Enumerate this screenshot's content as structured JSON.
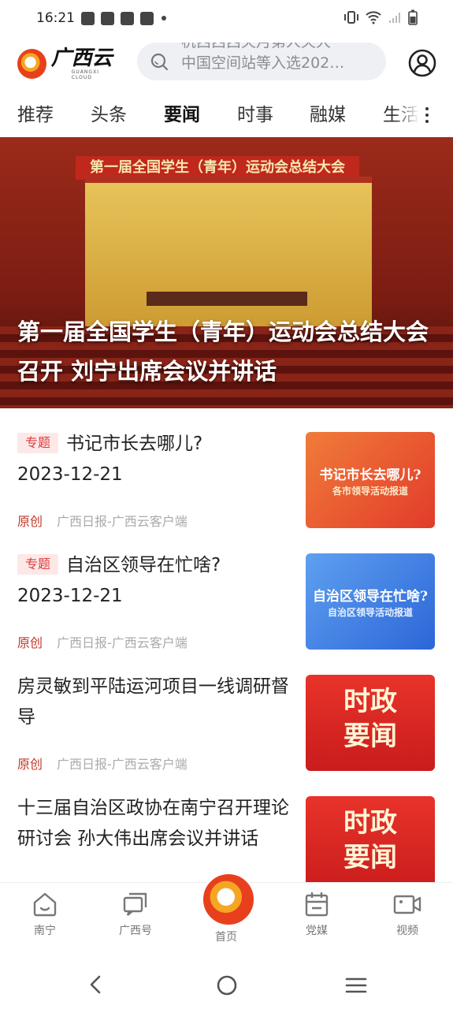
{
  "status": {
    "time": "16:21"
  },
  "app": {
    "logo_cn": "广西云",
    "logo_en": "GUANGXI CLOUD"
  },
  "search": {
    "line1": "杭西西西央月第人央大",
    "line2": "中国空间站等入选202…"
  },
  "tabs": [
    {
      "label": "推荐"
    },
    {
      "label": "头条"
    },
    {
      "label": "要闻"
    },
    {
      "label": "时事"
    },
    {
      "label": "融媒"
    },
    {
      "label": "生活"
    }
  ],
  "hero": {
    "banner": "第一届全国学生（青年）运动会总结大会",
    "title": "第一届全国学生（青年）运动会总结大会召开 刘宁出席会议并讲话"
  },
  "feed": [
    {
      "tag": "专题",
      "title": "书记市长去哪儿?",
      "date": "2023-12-21",
      "orig": "原创",
      "source": "广西日报-广西云客户端",
      "thumb_title": "书记市长去哪儿?",
      "thumb_sub": "各市领导活动报道"
    },
    {
      "tag": "专题",
      "title": "自治区领导在忙啥?",
      "date": "2023-12-21",
      "orig": "原创",
      "source": "广西日报-广西云客户端",
      "thumb_title": "自治区领导在忙啥?",
      "thumb_sub": "自治区领导活动报道"
    },
    {
      "title": "房灵敏到平陆运河项目一线调研督导",
      "orig": "原创",
      "source": "广西日报-广西云客户端",
      "thumb_title": "时政要闻"
    },
    {
      "title": "十三届自治区政协在南宁召开理论研讨会 孙大伟出席会议并讲话",
      "thumb_title": "时政要闻"
    }
  ],
  "bottom_nav": [
    {
      "label": "南宁",
      "icon": "home-icon"
    },
    {
      "label": "广西号",
      "icon": "chat-icon"
    },
    {
      "label": "首页",
      "icon": "logo-icon"
    },
    {
      "label": "党媒",
      "icon": "calendar-icon"
    },
    {
      "label": "视频",
      "icon": "video-icon"
    }
  ]
}
